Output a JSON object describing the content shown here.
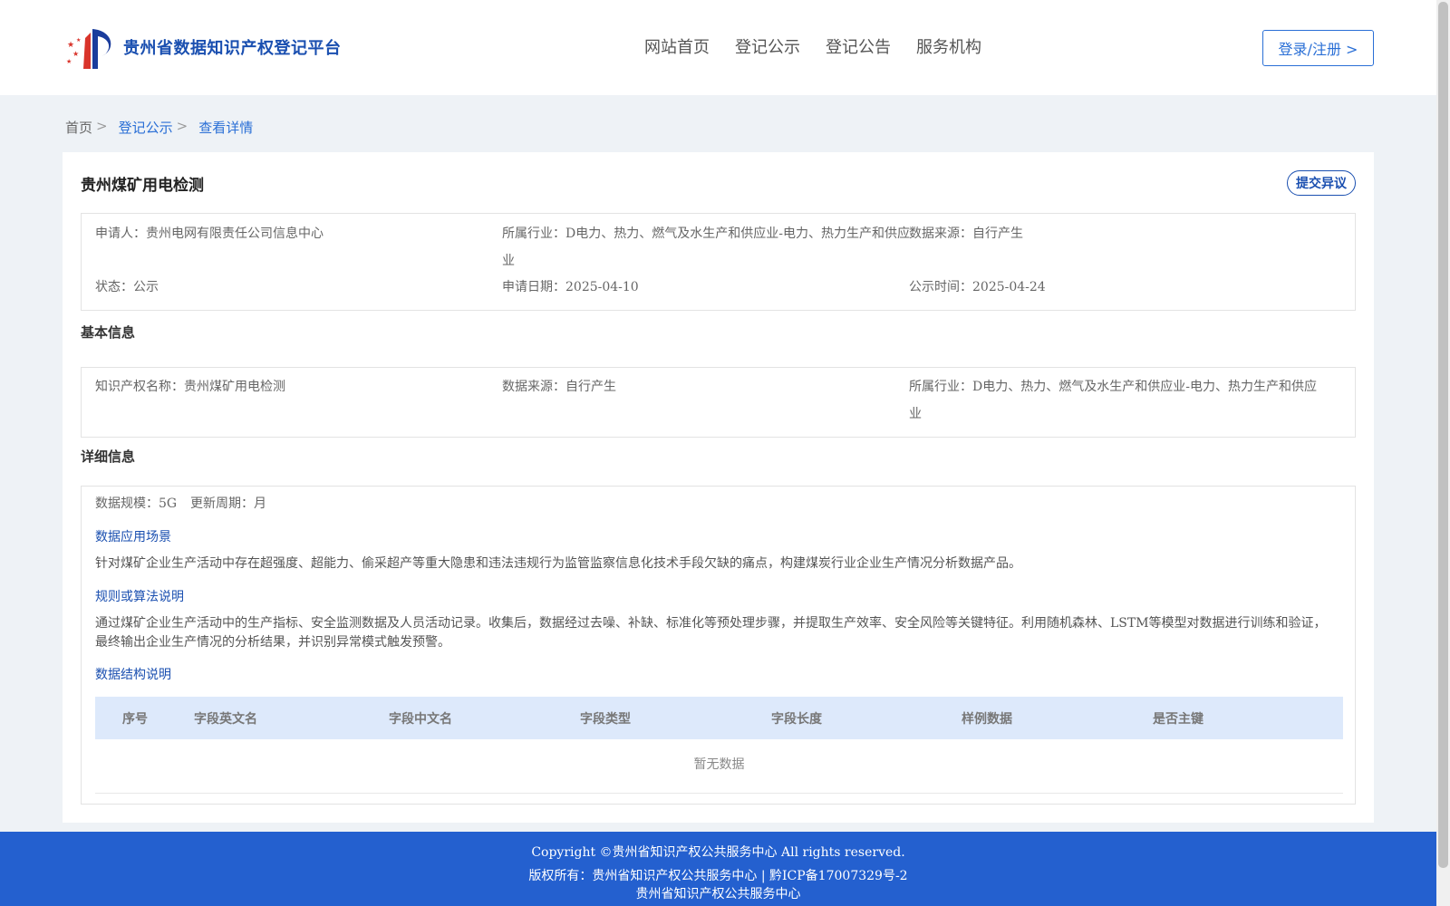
{
  "header": {
    "logo_text": "贵州省数据知识产权登记平台",
    "nav": [
      "网站首页",
      "登记公示",
      "登记公告",
      "服务机构"
    ],
    "login_label": "登录/注册 >"
  },
  "breadcrumb": {
    "home": "首页",
    "list": "登记公示",
    "current": "查看详情",
    "sep": ">"
  },
  "record": {
    "title": "贵州煤矿用电检测",
    "objection_label": "提交异议",
    "applicant_label": "申请人：",
    "applicant": "贵州电网有限责任公司信息中心",
    "industry_label": "所属行业：",
    "industry_line1": "D电力、热力、燃气及水生产和供应业-电力、热力生产和供应",
    "industry_line2": "业",
    "source_label": "数据来源：",
    "source": "自行产生",
    "status_label": "状态：",
    "status": "公示",
    "apply_date_label": "申请日期：",
    "apply_date": "2025-04-10",
    "publish_label": "公示时间：",
    "publish_date": "2025-04-24"
  },
  "basic": {
    "section_title": "基本信息",
    "name_label": "知识产权名称：",
    "name": "贵州煤矿用电检测",
    "source_label": "数据来源：",
    "source": "自行产生",
    "industry_label": "所属行业：",
    "industry_line1": "D电力、热力、燃气及水生产和供应业-电力、热力生产和供应",
    "industry_line2": "业"
  },
  "detail": {
    "section_title": "详细信息",
    "scale_label": "数据规模：",
    "scale": "5G",
    "period_label": "更新周期：",
    "period": "月",
    "scenario_title": "数据应用场景",
    "scenario_text": "针对煤矿企业生产活动中存在超强度、超能力、偷采超产等重大隐患和违法违规行为监管监察信息化技术手段欠缺的痛点，构建煤炭行业企业生产情况分析数据产品。",
    "algo_title": "规则或算法说明",
    "algo_text": "通过煤矿企业生产活动中的生产指标、安全监测数据及人员活动记录。收集后，数据经过去噪、补缺、标准化等预处理步骤，并提取生产效率、安全风险等关键特征。利用随机森林、LSTM等模型对数据进行训练和验证，最终输出企业生产情况的分析结果，并识别异常模式触发预警。",
    "structure_title": "数据结构说明",
    "columns": [
      "序号",
      "字段英文名",
      "字段中文名",
      "字段类型",
      "字段长度",
      "样例数据",
      "是否主键"
    ],
    "empty_text": "暂无数据"
  },
  "footer": {
    "copyright": "Copyright ©贵州省知识产权公共服务中心 All rights reserved.",
    "owner": "版权所有：贵州省知识产权公共服务中心 | 黔ICP备17007329号-2",
    "org": "贵州省知识产权公共服务中心"
  },
  "colors": {
    "brand": "#1a4fb0",
    "link": "#2a6fd6",
    "footer_bg": "#2460cf",
    "table_head_bg": "#dde9fb"
  }
}
